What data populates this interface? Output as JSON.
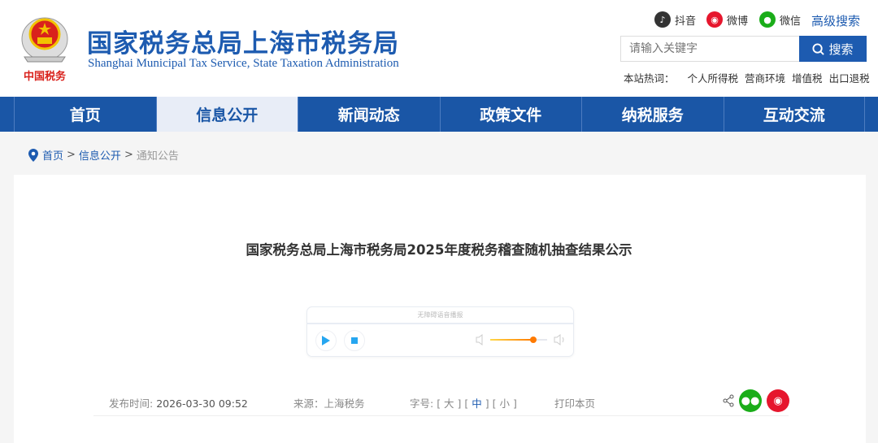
{
  "header": {
    "title_cn": "国家税务总局上海市税务局",
    "title_en": "Shanghai Municipal Tax Service, State Taxation Administration",
    "emblem_text": "中国税务",
    "social": [
      {
        "label": "抖音",
        "icon": "douyin-icon",
        "color": "#333333"
      },
      {
        "label": "微博",
        "icon": "weibo-icon",
        "color": "#e6162d"
      },
      {
        "label": "微信",
        "icon": "wechat-icon",
        "color": "#1aad19"
      }
    ],
    "advanced_search": "高级搜索",
    "search_placeholder": "请输入关键字",
    "search_button": "搜索",
    "hot_label": "本站热词：",
    "hot_words": [
      "个人所得税",
      "营商环境",
      "增值税",
      "出口退税"
    ]
  },
  "nav": {
    "items": [
      "首页",
      "信息公开",
      "新闻动态",
      "政策文件",
      "纳税服务",
      "互动交流"
    ],
    "active": "信息公开"
  },
  "breadcrumb": {
    "items": [
      "首页",
      "信息公开"
    ],
    "current": "通知公告"
  },
  "article": {
    "title": "国家税务总局上海市税务局2025年度税务稽查随机抽查结果公示",
    "player": {
      "title": "无障碍语音播报",
      "volume": 0.75
    },
    "meta": {
      "publish_label": "发布时间:",
      "publish_time": "2026-03-30 09:52",
      "source_label": "来源：",
      "source": "上海税务",
      "font_label": "字号:",
      "font_sizes": [
        "大",
        "中",
        "小"
      ],
      "font_active": "中",
      "print": "打印本页"
    }
  },
  "colors": {
    "brand": "#1a56a6",
    "accent": "#ff7a00"
  }
}
